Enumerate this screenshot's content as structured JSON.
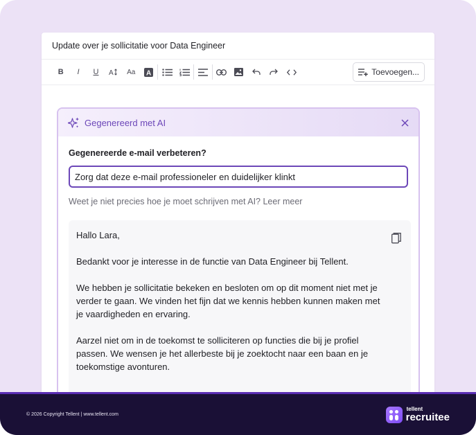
{
  "email": {
    "subject": "Update over je sollicitatie voor Data Engineer"
  },
  "toolbar": {
    "items": [
      {
        "name": "bold",
        "glyph": "B"
      },
      {
        "name": "italic",
        "glyph": "I"
      },
      {
        "name": "underline",
        "glyph": "U"
      },
      {
        "name": "font-size",
        "glyph": "A↕"
      },
      {
        "name": "text-case",
        "glyph": "Aa"
      },
      {
        "name": "text-color",
        "glyph": "A"
      }
    ],
    "insert_label": "Toevoegen..."
  },
  "ai_panel": {
    "title": "Gegenereerd met AI",
    "prompt_label": "Gegenereerde e-mail verbeteren?",
    "prompt_value": "Zorg dat deze e-mail professioneler en duidelijker klinkt",
    "help_text": "Weet je niet precies hoe je moet schrijven met AI?",
    "help_link": "Leer meer",
    "generated_email": {
      "greeting": "Hallo Lara,",
      "paragraph_1": "Bedankt voor je interesse in de functie van Data Engineer bij Tellent.",
      "paragraph_2": "We hebben je sollicitatie bekeken en besloten om op dit moment niet met je verder te gaan. We vinden het fijn dat we kennis hebben kunnen maken met je vaardigheden en ervaring.",
      "paragraph_3": "Aarzel niet om in de toekomst te solliciteren op functies die bij je profiel passen. We wensen je het allerbeste bij je zoektocht naar een baan en je toekomstige avonturen."
    }
  },
  "footer": {
    "copyright": "© 2026 Copyright Tellent | www.tellent.com",
    "brand_top": "tellent",
    "brand_main": "recruitee"
  },
  "colors": {
    "accent": "#6c47b8",
    "background": "#ece2f6",
    "footer": "#1a1036"
  }
}
